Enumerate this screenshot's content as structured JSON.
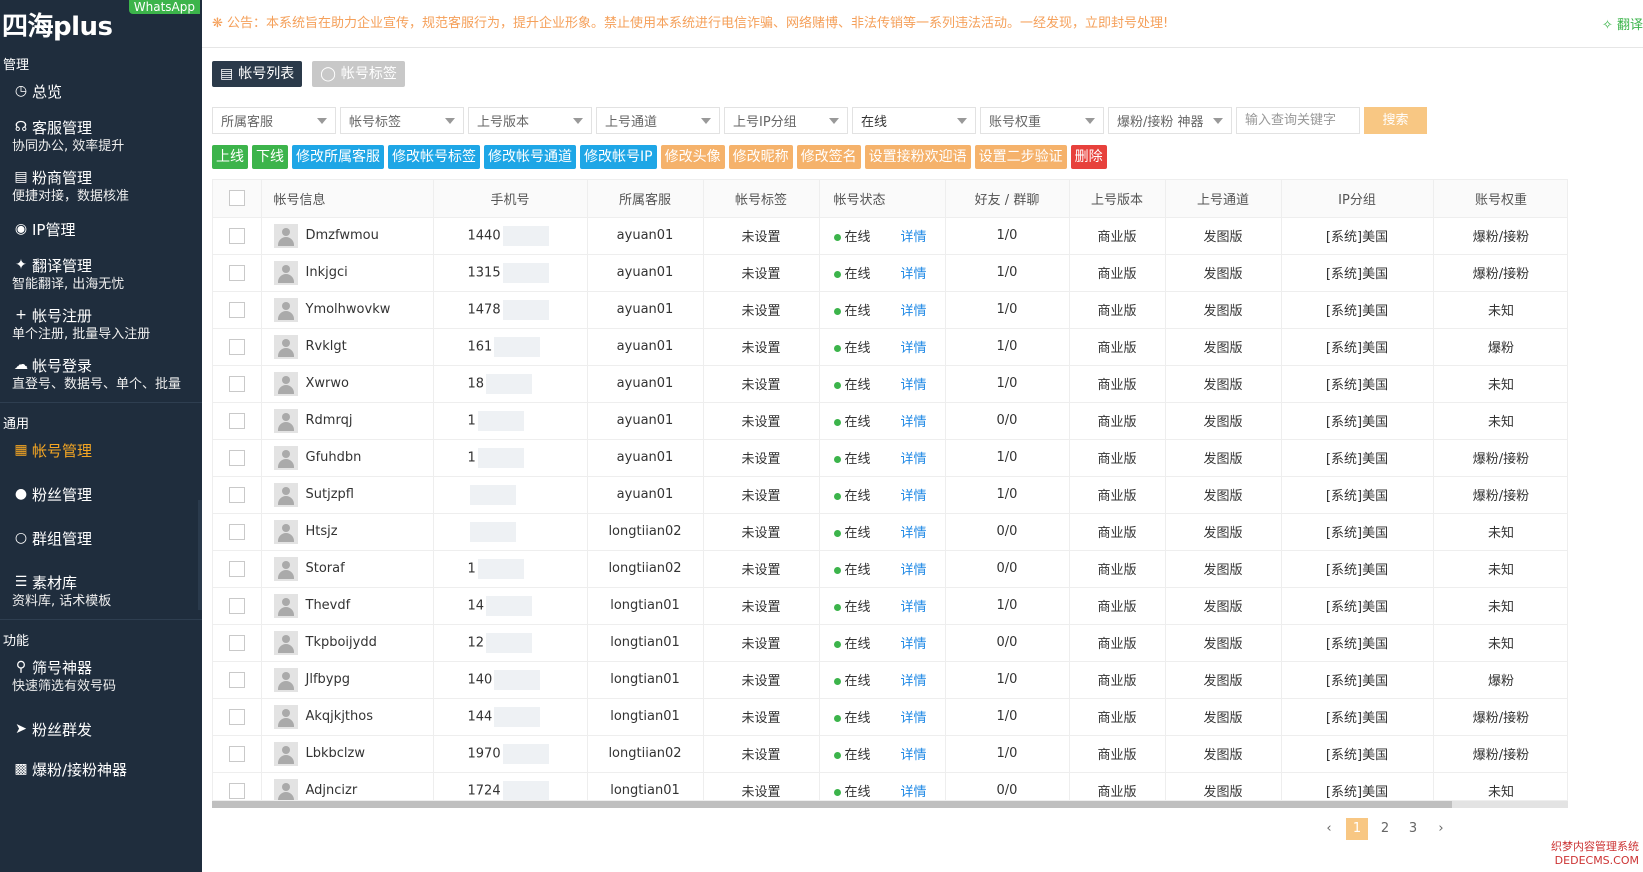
{
  "brand": {
    "title": "四海plus",
    "badge": "WhatsApp"
  },
  "sidebar": {
    "sections": [
      {
        "label": "管理"
      },
      {
        "label": "通用"
      },
      {
        "label": "功能"
      }
    ],
    "items": [
      {
        "label": "总览",
        "sub": "",
        "icon": "dashboard-icon"
      },
      {
        "label": "客服管理",
        "sub": "协同办公, 效率提升",
        "icon": "headset-icon"
      },
      {
        "label": "粉商管理",
        "sub": "便捷对接，数据核准",
        "icon": "document-icon"
      },
      {
        "label": "IP管理",
        "sub": "",
        "icon": "globe-icon"
      },
      {
        "label": "翻译管理",
        "sub": "智能翻译, 出海无忧",
        "icon": "translate-icon"
      },
      {
        "label": "帐号注册",
        "sub": "单个注册, 批量导入注册",
        "icon": "plus-icon"
      },
      {
        "label": "帐号登录",
        "sub": "直登号、数据号、单个、批量",
        "icon": "cloud-upload-icon"
      },
      {
        "label": "帐号管理",
        "sub": "",
        "icon": "grid-icon"
      },
      {
        "label": "粉丝管理",
        "sub": "",
        "icon": "user-icon"
      },
      {
        "label": "群组管理",
        "sub": "",
        "icon": "group-icon"
      },
      {
        "label": "素材库",
        "sub": "资料库, 话术模板",
        "icon": "layers-icon"
      },
      {
        "label": "筛号神器",
        "sub": "快速筛选有效号码",
        "icon": "search-icon"
      },
      {
        "label": "粉丝群发",
        "sub": "",
        "icon": "send-icon"
      },
      {
        "label": "爆粉/接粉神器",
        "sub": "",
        "icon": "chart-icon"
      }
    ]
  },
  "topbar": {
    "notice": "公告：本系统旨在助力企业宣传，规范客服行为，提升企业形象。禁止使用本系统进行电信诈骗、网络赌博、非法传销等一系列违法活动。一经发现，立即封号处理!",
    "translate": "翻译"
  },
  "tabs": [
    {
      "label": "帐号列表",
      "icon": "list-icon"
    },
    {
      "label": "帐号标签",
      "icon": "tag-icon"
    }
  ],
  "filters": {
    "selects": [
      "所属客服",
      "帐号标签",
      "上号版本",
      "上号通道",
      "上号IP分组",
      "在线",
      "账号权重",
      "爆粉/接粉 神器"
    ],
    "keyword_placeholder": "输入查询关键字",
    "search_label": "搜索"
  },
  "actions": [
    {
      "label": "上线",
      "color": "green"
    },
    {
      "label": "下线",
      "color": "green"
    },
    {
      "label": "修改所属客服",
      "color": "blue"
    },
    {
      "label": "修改帐号标签",
      "color": "blue"
    },
    {
      "label": "修改帐号通道",
      "color": "blue"
    },
    {
      "label": "修改帐号IP",
      "color": "blue"
    },
    {
      "label": "修改头像",
      "color": "orange"
    },
    {
      "label": "修改昵称",
      "color": "orange"
    },
    {
      "label": "修改签名",
      "color": "orange"
    },
    {
      "label": "设置接粉欢迎语",
      "color": "orange"
    },
    {
      "label": "设置二步验证",
      "color": "orange"
    },
    {
      "label": "删除",
      "color": "red"
    }
  ],
  "table": {
    "headers": [
      "帐号信息",
      "手机号",
      "所属客服",
      "帐号标签",
      "帐号状态",
      "好友 / 群聊",
      "上号版本",
      "上号通道",
      "IP分组",
      "账号权重"
    ],
    "rows": [
      {
        "name": "Dmzfwmou",
        "phone": "1440",
        "agent": "ayuan01",
        "tag": "未设置",
        "status": "在线",
        "detail": "详情",
        "friends": "1/0",
        "version": "商业版",
        "channel": "发图版",
        "ip": "[系统]美国",
        "weight": "爆粉/接粉"
      },
      {
        "name": "Inkjgci",
        "phone": "1315",
        "agent": "ayuan01",
        "tag": "未设置",
        "status": "在线",
        "detail": "详情",
        "friends": "1/0",
        "version": "商业版",
        "channel": "发图版",
        "ip": "[系统]美国",
        "weight": "爆粉/接粉"
      },
      {
        "name": "Ymolhwovkw",
        "phone": "1478",
        "agent": "ayuan01",
        "tag": "未设置",
        "status": "在线",
        "detail": "详情",
        "friends": "1/0",
        "version": "商业版",
        "channel": "发图版",
        "ip": "[系统]美国",
        "weight": "未知"
      },
      {
        "name": "Rvklgt",
        "phone": "161",
        "agent": "ayuan01",
        "tag": "未设置",
        "status": "在线",
        "detail": "详情",
        "friends": "1/0",
        "version": "商业版",
        "channel": "发图版",
        "ip": "[系统]美国",
        "weight": "爆粉"
      },
      {
        "name": "Xwrwo",
        "phone": "18",
        "agent": "ayuan01",
        "tag": "未设置",
        "status": "在线",
        "detail": "详情",
        "friends": "1/0",
        "version": "商业版",
        "channel": "发图版",
        "ip": "[系统]美国",
        "weight": "未知"
      },
      {
        "name": "Rdmrqj",
        "phone": "1",
        "agent": "ayuan01",
        "tag": "未设置",
        "status": "在线",
        "detail": "详情",
        "friends": "0/0",
        "version": "商业版",
        "channel": "发图版",
        "ip": "[系统]美国",
        "weight": "未知"
      },
      {
        "name": "Gfuhdbn",
        "phone": "1",
        "agent": "ayuan01",
        "tag": "未设置",
        "status": "在线",
        "detail": "详情",
        "friends": "1/0",
        "version": "商业版",
        "channel": "发图版",
        "ip": "[系统]美国",
        "weight": "爆粉/接粉"
      },
      {
        "name": "Sutjzpfl",
        "phone": "",
        "agent": "ayuan01",
        "tag": "未设置",
        "status": "在线",
        "detail": "详情",
        "friends": "1/0",
        "version": "商业版",
        "channel": "发图版",
        "ip": "[系统]美国",
        "weight": "爆粉/接粉"
      },
      {
        "name": "Htsjz",
        "phone": "",
        "agent": "longtiian02",
        "tag": "未设置",
        "status": "在线",
        "detail": "详情",
        "friends": "0/0",
        "version": "商业版",
        "channel": "发图版",
        "ip": "[系统]美国",
        "weight": "未知"
      },
      {
        "name": "Storaf",
        "phone": "1",
        "agent": "longtiian02",
        "tag": "未设置",
        "status": "在线",
        "detail": "详情",
        "friends": "0/0",
        "version": "商业版",
        "channel": "发图版",
        "ip": "[系统]美国",
        "weight": "未知"
      },
      {
        "name": "Thevdf",
        "phone": "14",
        "agent": "longtian01",
        "tag": "未设置",
        "status": "在线",
        "detail": "详情",
        "friends": "1/0",
        "version": "商业版",
        "channel": "发图版",
        "ip": "[系统]美国",
        "weight": "未知"
      },
      {
        "name": "Tkpboijydd",
        "phone": "12",
        "agent": "longtian01",
        "tag": "未设置",
        "status": "在线",
        "detail": "详情",
        "friends": "0/0",
        "version": "商业版",
        "channel": "发图版",
        "ip": "[系统]美国",
        "weight": "未知"
      },
      {
        "name": "Jlfbypg",
        "phone": "140",
        "agent": "longtian01",
        "tag": "未设置",
        "status": "在线",
        "detail": "详情",
        "friends": "1/0",
        "version": "商业版",
        "channel": "发图版",
        "ip": "[系统]美国",
        "weight": "爆粉"
      },
      {
        "name": "Akqjkjthos",
        "phone": "144",
        "agent": "longtian01",
        "tag": "未设置",
        "status": "在线",
        "detail": "详情",
        "friends": "1/0",
        "version": "商业版",
        "channel": "发图版",
        "ip": "[系统]美国",
        "weight": "爆粉/接粉"
      },
      {
        "name": "Lbkbclzw",
        "phone": "1970",
        "agent": "longtiian02",
        "tag": "未设置",
        "status": "在线",
        "detail": "详情",
        "friends": "1/0",
        "version": "商业版",
        "channel": "发图版",
        "ip": "[系统]美国",
        "weight": "爆粉/接粉"
      },
      {
        "name": "Adjncizr",
        "phone": "1724",
        "agent": "longtian01",
        "tag": "未设置",
        "status": "在线",
        "detail": "详情",
        "friends": "0/0",
        "version": "商业版",
        "channel": "发图版",
        "ip": "[系统]美国",
        "weight": "未知"
      }
    ]
  },
  "pagination": {
    "prev": "‹",
    "pages": [
      "1",
      "2",
      "3"
    ],
    "next": "›",
    "current": "1"
  },
  "watermark": {
    "line1": "织梦内容管理系统",
    "line2": "DEDECMS.COM"
  }
}
